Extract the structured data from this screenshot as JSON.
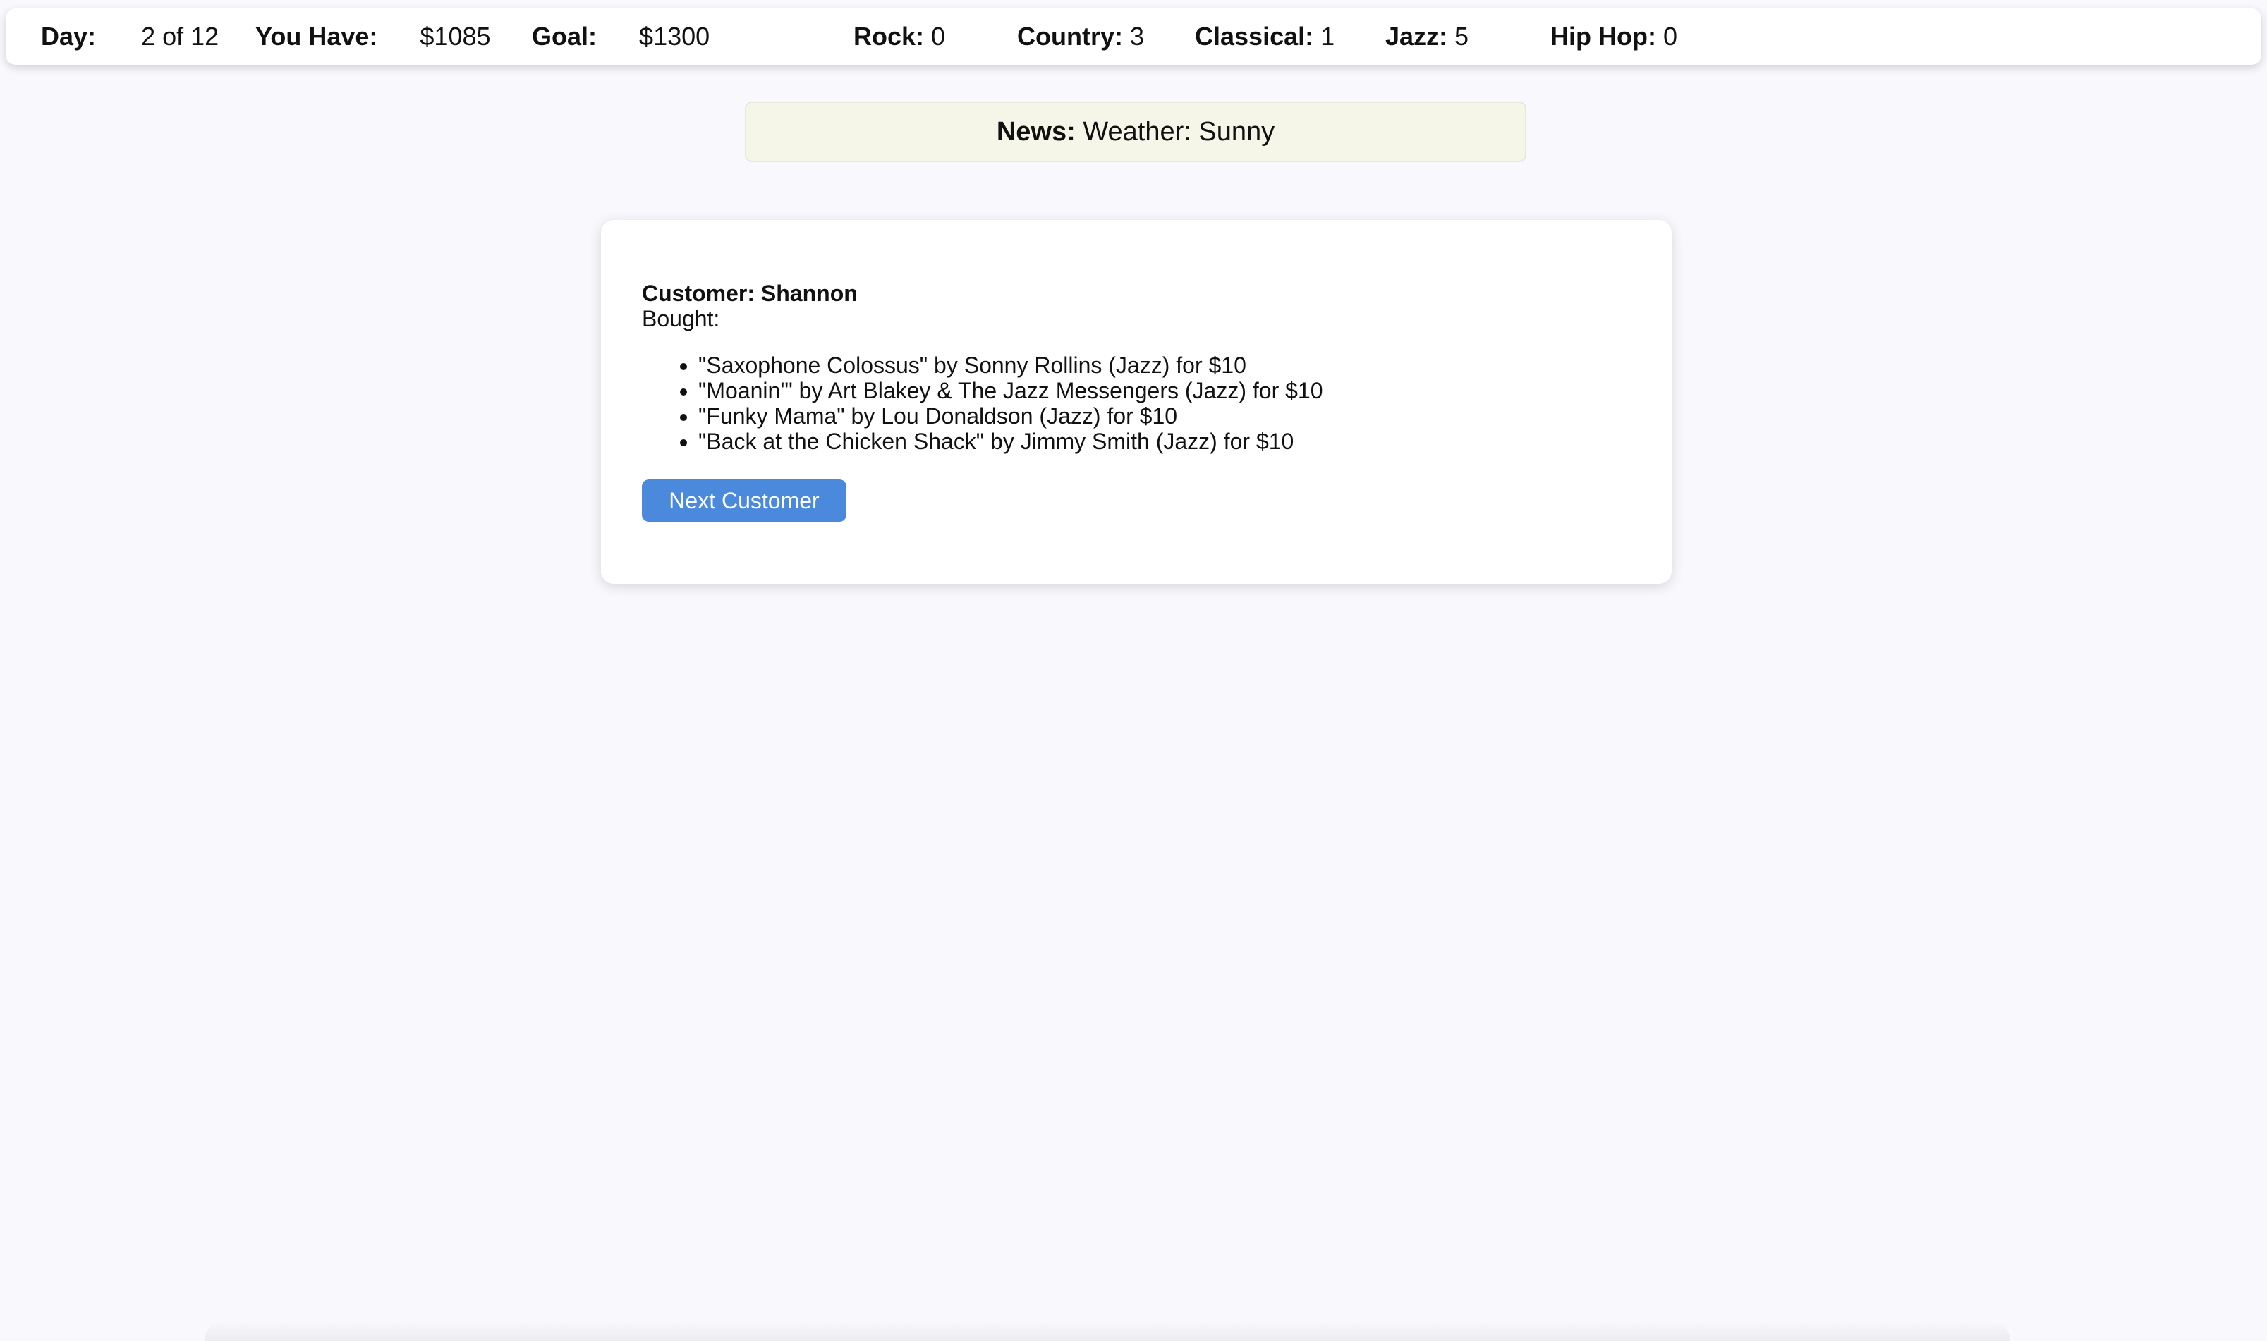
{
  "stats": {
    "day": {
      "label": "Day:",
      "value": "2 of 12"
    },
    "money": {
      "label": "You Have:",
      "value": "$1085"
    },
    "goal": {
      "label": "Goal:",
      "value": "$1300"
    },
    "rock": {
      "label": "Rock:",
      "value": "0"
    },
    "country": {
      "label": "Country:",
      "value": "3"
    },
    "classical": {
      "label": "Classical:",
      "value": "1"
    },
    "jazz": {
      "label": "Jazz:",
      "value": "5"
    },
    "hiphop": {
      "label": "Hip Hop:",
      "value": "0"
    }
  },
  "news": {
    "label": "News:",
    "text": "Weather: Sunny"
  },
  "customer": {
    "name_line": "Customer: Shannon",
    "bought_label": "Bought:",
    "purchases": [
      "\"Saxophone Colossus\" by Sonny Rollins (Jazz) for $10",
      "\"Moanin'\" by Art Blakey & The Jazz Messengers (Jazz) for $10",
      "\"Funky Mama\" by Lou Donaldson (Jazz) for $10",
      "\"Back at the Chicken Shack\" by Jimmy Smith (Jazz) for $10"
    ],
    "next_button_label": "Next Customer"
  },
  "colors": {
    "accent": "#4a89dc",
    "news_background": "#f5f5e8",
    "page_background": "#f8f8fd"
  }
}
